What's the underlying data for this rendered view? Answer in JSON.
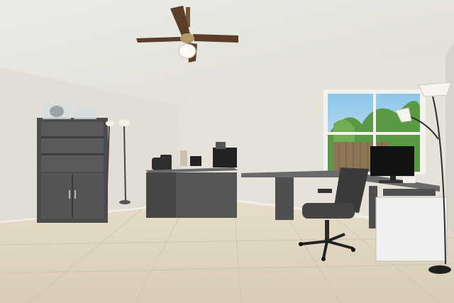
{
  "photo": {
    "subject": "home-office",
    "colors": {
      "wall": "#e4e0d8",
      "ceiling": "#e9e6df",
      "floor": "#ddd2bd",
      "furniture": "#4f4f4f",
      "desktop": "#6a6a6a",
      "window_sky": "#a9d4ee",
      "foliage": "#5b9a45",
      "fence": "#8d7656"
    },
    "objects": [
      "ceiling-fan",
      "bookshelf-cabinet",
      "floor-lamp",
      "executive-desk",
      "l-shaped-desk",
      "office-chair",
      "window",
      "computer-monitor",
      "arc-floor-lamp",
      "white-file-cabinet"
    ]
  }
}
